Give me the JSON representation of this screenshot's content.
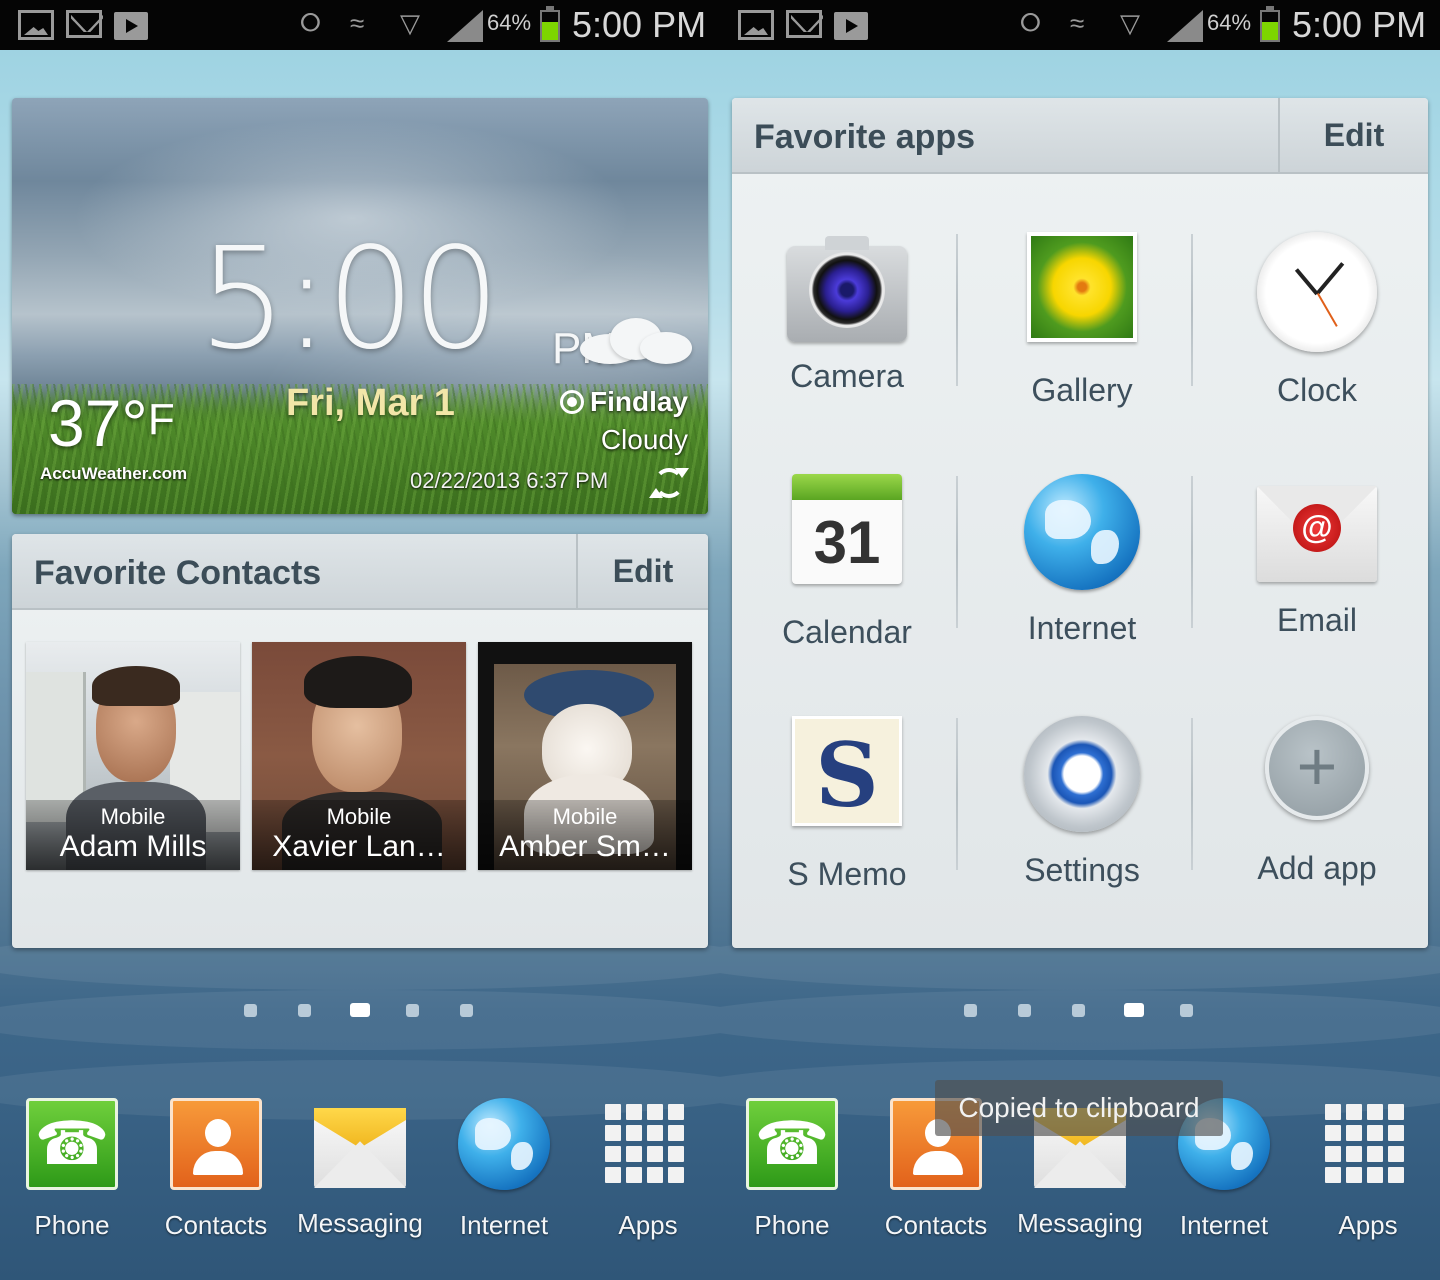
{
  "status_bar": {
    "battery_percent": "64%",
    "battery_level": 0.64,
    "time": "5:00 PM",
    "icons": [
      "picture-notification-icon",
      "gmail-icon",
      "play-store-icon",
      "nfc-icon",
      "vibrate-icon",
      "wifi-icon",
      "signal-icon",
      "battery-icon"
    ],
    "battery_color": "#7dd600"
  },
  "left_screen": {
    "clock_widget": {
      "time": "5:00",
      "ampm": "PM",
      "date": "Fri, Mar 1",
      "temperature": "37°",
      "temp_unit": "F",
      "provider": "AccuWeather.com",
      "city": "Findlay",
      "condition": "Cloudy",
      "updated": "02/22/2013 6:37 PM",
      "date_color": "#f2e6a8"
    },
    "favorite_contacts": {
      "title": "Favorite Contacts",
      "edit_label": "Edit",
      "contacts": [
        {
          "type": "Mobile",
          "name": "Adam Mills"
        },
        {
          "type": "Mobile",
          "name": "Xavier Lan…"
        },
        {
          "type": "Mobile",
          "name": "Amber Sm…"
        }
      ]
    },
    "page_indicator": {
      "count": 5,
      "active_index": 2
    }
  },
  "right_screen": {
    "favorite_apps": {
      "title": "Favorite apps",
      "edit_label": "Edit",
      "apps": [
        {
          "label": "Camera",
          "icon": "camera-icon"
        },
        {
          "label": "Gallery",
          "icon": "gallery-icon"
        },
        {
          "label": "Clock",
          "icon": "clock-icon"
        },
        {
          "label": "Calendar",
          "icon": "calendar-icon",
          "badge": "31"
        },
        {
          "label": "Internet",
          "icon": "globe-icon"
        },
        {
          "label": "Email",
          "icon": "email-icon"
        },
        {
          "label": "S Memo",
          "icon": "s-memo-icon",
          "glyph": "S"
        },
        {
          "label": "Settings",
          "icon": "settings-gear-icon"
        },
        {
          "label": "Add app",
          "icon": "add-icon"
        }
      ]
    },
    "page_indicator": {
      "count": 5,
      "active_index": 3
    },
    "toast": "Copied to clipboard"
  },
  "dock": {
    "items": [
      {
        "label": "Phone",
        "icon": "phone-icon"
      },
      {
        "label": "Contacts",
        "icon": "contacts-icon"
      },
      {
        "label": "Messaging",
        "icon": "messaging-icon"
      },
      {
        "label": "Internet",
        "icon": "globe-icon"
      },
      {
        "label": "Apps",
        "icon": "apps-grid-icon"
      }
    ]
  }
}
